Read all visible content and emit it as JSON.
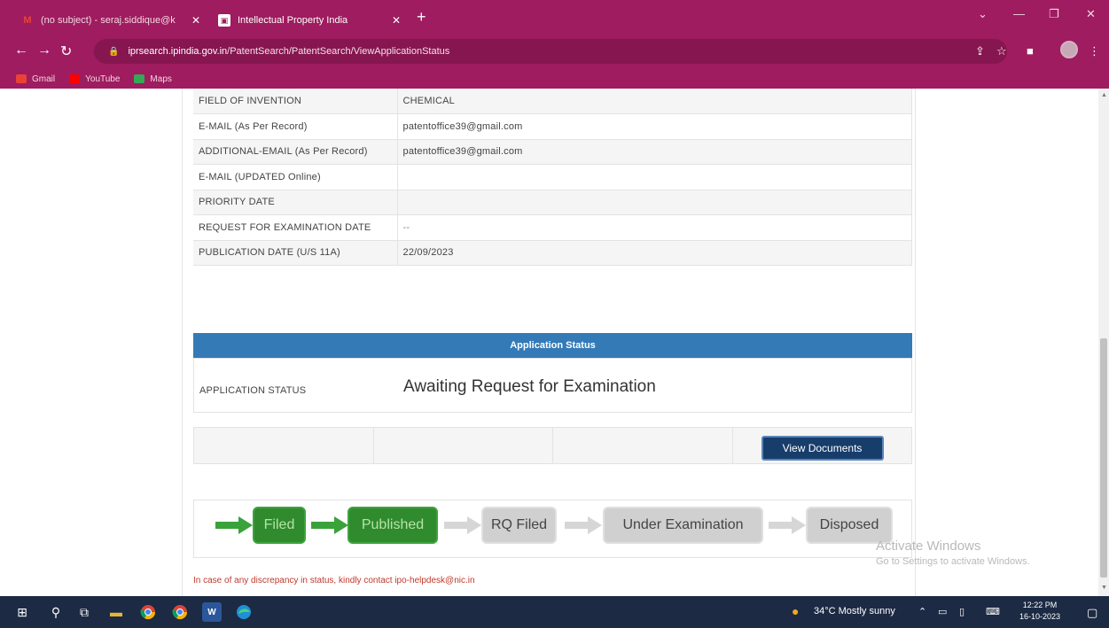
{
  "browser": {
    "tabs": [
      {
        "label": "(no subject) - seraj.siddique@k",
        "icon": "gmail-icon",
        "active": false
      },
      {
        "label": "Intellectual Property India",
        "icon": "ipindia-icon",
        "active": true
      }
    ],
    "url_host": "iprsearch.ipindia.gov.in",
    "url_path": "/PatentSearch/PatentSearch/ViewApplicationStatus",
    "bookmarks": [
      {
        "label": "Gmail",
        "color": "#ea4335"
      },
      {
        "label": "YouTube",
        "color": "#ff0000"
      },
      {
        "label": "Maps",
        "color": "#34a853"
      }
    ]
  },
  "details": [
    {
      "label": "FIELD OF INVENTION",
      "value": "CHEMICAL"
    },
    {
      "label": "E-MAIL (As Per Record)",
      "value": "patentoffice39@gmail.com"
    },
    {
      "label": "ADDITIONAL-EMAIL (As Per Record)",
      "value": "patentoffice39@gmail.com"
    },
    {
      "label": "E-MAIL (UPDATED Online)",
      "value": ""
    },
    {
      "label": "PRIORITY DATE",
      "value": ""
    },
    {
      "label": "REQUEST FOR EXAMINATION DATE",
      "value": "--"
    },
    {
      "label": "PUBLICATION DATE (U/S 11A)",
      "value": "22/09/2023"
    }
  ],
  "status_section": {
    "header": "Application Status",
    "label": "APPLICATION STATUS",
    "value": "Awaiting Request for Examination"
  },
  "documents": {
    "button_label": "View Documents"
  },
  "workflow": [
    {
      "label": "Filed",
      "state": "done"
    },
    {
      "label": "Published",
      "state": "done"
    },
    {
      "label": "RQ Filed",
      "state": "pending"
    },
    {
      "label": "Under Examination",
      "state": "pending"
    },
    {
      "label": "Disposed",
      "state": "pending"
    }
  ],
  "note": "In case of any discrepancy in status, kindly contact ipo-helpdesk@nic.in",
  "watermark": {
    "title": "Activate Windows",
    "subtitle": "Go to Settings to activate Windows."
  },
  "taskbar": {
    "weather": "34°C  Mostly sunny",
    "time": "12:22 PM",
    "date": "16-10-2023"
  },
  "colors": {
    "chrome": "#9e1c5f",
    "header_blue": "#337ab7",
    "done_green": "#2f8b2e",
    "pending_gray": "#d0d0d0",
    "arrow_done": "#3aa23a",
    "arrow_pending": "#d6d6d6"
  }
}
